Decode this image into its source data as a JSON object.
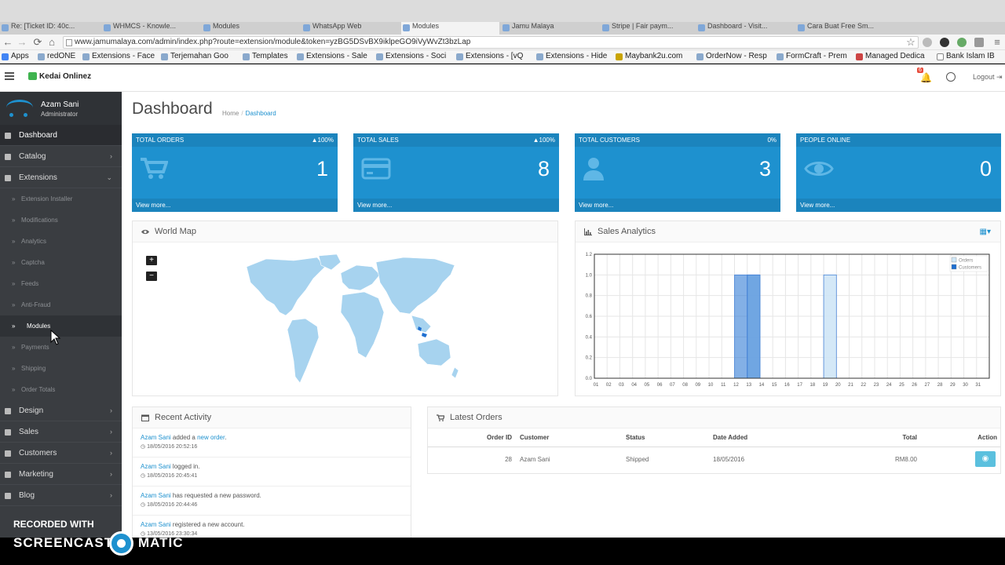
{
  "browser": {
    "tabs": [
      "Re: [Ticket ID: 40c...",
      "WHMCS - Knowle...",
      "Modules",
      "WhatsApp Web",
      "Modules",
      "Jamu Malaya",
      "Stripe | Fair paym...",
      "Dashboard - Visit...",
      "Cara Buat Free Sm..."
    ],
    "url": "www.jamumalaya.com/admin/index.php?route=extension/module&token=yzBG5DSvBX9iklpeGO9iVyWvZt3bzLap",
    "bookmarks": [
      "Apps",
      "redONE",
      "Extensions - Face",
      "Terjemahan Goo",
      "Templates",
      "Extensions - Sale",
      "Extensions - Soci",
      "Extensions - [vQ",
      "Extensions - Hide",
      "Maybank2u.com",
      "OrderNow - Resp",
      "FormCraft - Prem",
      "Managed Dedica",
      "Bank Islam IB"
    ]
  },
  "header": {
    "logo": "Kedai Onlinez",
    "notification_count": "6",
    "logout": "Logout"
  },
  "sidebar": {
    "user_name": "Azam Sani",
    "user_role": "Administrator",
    "menu": [
      {
        "label": "Dashboard"
      },
      {
        "label": "Catalog"
      },
      {
        "label": "Extensions"
      }
    ],
    "extensions_sub": [
      "Extension Installer",
      "Modifications",
      "Analytics",
      "Captcha",
      "Feeds",
      "Anti-Fraud",
      "Modules",
      "Payments",
      "Shipping",
      "Order Totals"
    ],
    "menu_after": [
      {
        "label": "Design"
      },
      {
        "label": "Sales"
      },
      {
        "label": "Customers"
      },
      {
        "label": "Marketing"
      },
      {
        "label": "Blog"
      }
    ]
  },
  "page": {
    "title": "Dashboard",
    "breadcrumb_home": "Home",
    "breadcrumb_current": "Dashboard"
  },
  "tiles": [
    {
      "label": "TOTAL ORDERS",
      "pct": "▲100%",
      "value": "1",
      "link": "View more...",
      "icon": "cart-icon"
    },
    {
      "label": "TOTAL SALES",
      "pct": "▲100%",
      "value": "8",
      "link": "View more...",
      "icon": "credit-card-icon"
    },
    {
      "label": "TOTAL CUSTOMERS",
      "pct": "0%",
      "value": "3",
      "link": "View more...",
      "icon": "user-icon"
    },
    {
      "label": "PEOPLE ONLINE",
      "pct": "",
      "value": "0",
      "link": "View more...",
      "icon": "eye-icon"
    }
  ],
  "world_map": {
    "title": "World Map",
    "zoom_in": "+",
    "zoom_out": "−"
  },
  "sales_analytics": {
    "title": "Sales Analytics"
  },
  "chart_data": {
    "type": "bar",
    "categories": [
      "01",
      "02",
      "03",
      "04",
      "05",
      "06",
      "07",
      "08",
      "09",
      "10",
      "11",
      "12",
      "13",
      "14",
      "15",
      "16",
      "17",
      "18",
      "19",
      "20",
      "21",
      "22",
      "23",
      "24",
      "25",
      "26",
      "27",
      "28",
      "29",
      "30",
      "31"
    ],
    "series": [
      {
        "name": "Orders",
        "values": [
          0,
          0,
          0,
          0,
          0,
          0,
          0,
          0,
          0,
          0,
          0,
          0,
          1,
          0,
          0,
          0,
          0,
          0,
          1,
          0,
          0,
          0,
          0,
          0,
          0,
          0,
          0,
          0,
          0,
          0,
          0
        ]
      },
      {
        "name": "Customers",
        "values": [
          0,
          0,
          0,
          0,
          0,
          0,
          0,
          0,
          0,
          0,
          0,
          1,
          1,
          0,
          0,
          0,
          0,
          0,
          0,
          0,
          0,
          0,
          0,
          0,
          0,
          0,
          0,
          0,
          0,
          0,
          0
        ]
      }
    ],
    "ylim": [
      0,
      1.2
    ],
    "yticks": [
      "0.0",
      "0.2",
      "0.4",
      "0.6",
      "0.8",
      "1.0",
      "1.2"
    ],
    "grid": true,
    "legend": "top-right",
    "colors": {
      "Orders": "#cfe6f6",
      "Customers": "#1e6fd1"
    }
  },
  "activity": {
    "title": "Recent Activity",
    "items": [
      {
        "actor": "Azam Sani",
        "text": " added a ",
        "link": "new order",
        "tail": ".",
        "time": "18/05/2016 20:52:16"
      },
      {
        "actor": "Azam Sani",
        "text": " logged in.",
        "link": "",
        "tail": "",
        "time": "18/05/2016 20:45:41"
      },
      {
        "actor": "Azam Sani",
        "text": " has requested a new password.",
        "link": "",
        "tail": "",
        "time": "18/05/2016 20:44:46"
      },
      {
        "actor": "Azam Sani",
        "text": " registered a new account.",
        "link": "",
        "tail": "",
        "time": "13/05/2016 23:30:34"
      }
    ]
  },
  "orders": {
    "title": "Latest Orders",
    "columns": [
      "Order ID",
      "Customer",
      "Status",
      "Date Added",
      "Total",
      "Action"
    ],
    "rows": [
      {
        "id": "28",
        "customer": "Azam Sani",
        "status": "Shipped",
        "date": "18/05/2016",
        "total": "RM8.00"
      }
    ]
  },
  "watermark": {
    "line1": "RECORDED WITH",
    "line2": "SCREENCAST",
    "line3": "MATIC"
  }
}
